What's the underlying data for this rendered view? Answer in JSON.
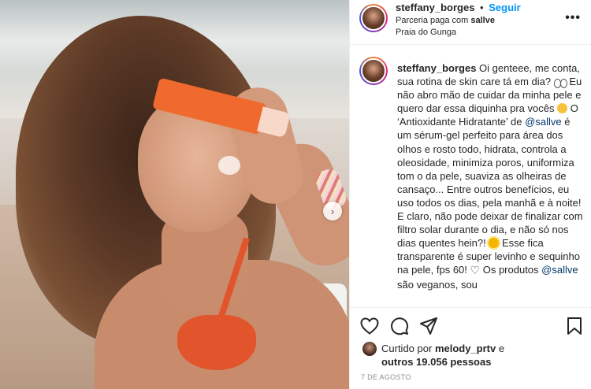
{
  "post": {
    "author": "steffany_borges",
    "follow_label": "Seguir",
    "dot": "•",
    "partnership_prefix": "Parceria paga com",
    "partner": "sallve",
    "location": "Praia do Gunga",
    "more_label": "•••",
    "next_label": "›"
  },
  "caption": {
    "author": "steffany_borges",
    "t1": "Oi genteee, me conta, sua rotina de skin care tá em dia?",
    "t2": "Eu não abro mão de cuidar da minha pele e quero dar essa diquinha pra vocês",
    "t3": "O ‘Antioxidante Hidratante’ de",
    "mention1": "@sallve",
    "t4": "é um sérum-gel perfeito para área dos olhos e rosto todo, hidrata, controla a oleosidade, minimiza poros, uniformiza tom o da pele, suaviza as olheiras de cansaço... Entre outros benefícios, eu uso todos os dias, pela manhã e à noite! E claro, não pode deixar de finalizar com filtro solar durante o dia, e não só nos dias quentes hein?!",
    "t5": "Esse fica transparente é super levinho e sequinho na pele, fps 60!",
    "t6": "Os produtos",
    "mention2": "@sallve",
    "t7": "são veganos, sou",
    "emoji_eyes": "eyes",
    "emoji_smile": "smiling-face",
    "emoji_sun": "sun",
    "emoji_heart": "♡"
  },
  "actions": {
    "liked_by_prefix": "Curtido por",
    "liked_by_user": "melody_prtv",
    "liked_by_and": "e",
    "others": "outros 19.056 pessoas",
    "date": "7 de agosto"
  },
  "colors": {
    "accent": "#0095f6",
    "mention": "#00376b",
    "bikini": "#e2542b",
    "tube": "#f06a30"
  }
}
